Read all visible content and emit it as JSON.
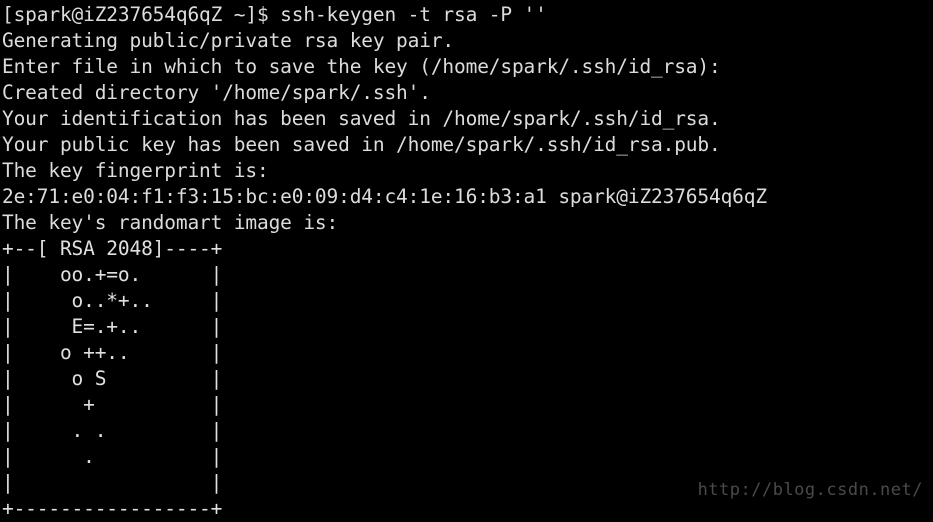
{
  "terminal": {
    "colors": {
      "background": "#000000",
      "foreground": "#dcdcdc",
      "watermark": "#4a4a4a"
    },
    "prompt": {
      "user": "spark",
      "host": "iZ237654q6qZ",
      "cwd": "~",
      "symbol": "$",
      "full": "[spark@iZ237654q6qZ ~]$ ",
      "command": "ssh-keygen -t rsa -P ''"
    },
    "lines": [
      "[spark@iZ237654q6qZ ~]$ ssh-keygen -t rsa -P ''",
      "Generating public/private rsa key pair.",
      "Enter file in which to save the key (/home/spark/.ssh/id_rsa): ",
      "Created directory '/home/spark/.ssh'.",
      "Your identification has been saved in /home/spark/.ssh/id_rsa.",
      "Your public key has been saved in /home/spark/.ssh/id_rsa.pub.",
      "The key fingerprint is:",
      "2e:71:e0:04:f1:f3:15:bc:e0:09:d4:c4:1e:16:b3:a1 spark@iZ237654q6qZ",
      "The key's randomart image is:",
      "+--[ RSA 2048]----+",
      "|    oo.+=o.      |",
      "|     o..*+..     |",
      "|     E=.+..      |",
      "|    o ++..       |",
      "|     o S         |",
      "|      +          |",
      "|     . .         |",
      "|      .          |",
      "|                 |",
      "+-----------------+"
    ],
    "details": {
      "key_type": "rsa",
      "key_bits": "2048",
      "passphrase_flag": "-P ''",
      "private_key_path": "/home/spark/.ssh/id_rsa",
      "public_key_path": "/home/spark/.ssh/id_rsa.pub",
      "created_directory": "/home/spark/.ssh",
      "fingerprint": "2e:71:e0:04:f1:f3:15:bc:e0:09:d4:c4:1e:16:b3:a1",
      "fingerprint_comment": "spark@iZ237654q6qZ",
      "randomart_header": "+--[ RSA 2048]----+",
      "randomart_footer": "+-----------------+"
    }
  },
  "watermark": {
    "text": "http://blog.csdn.net/"
  }
}
